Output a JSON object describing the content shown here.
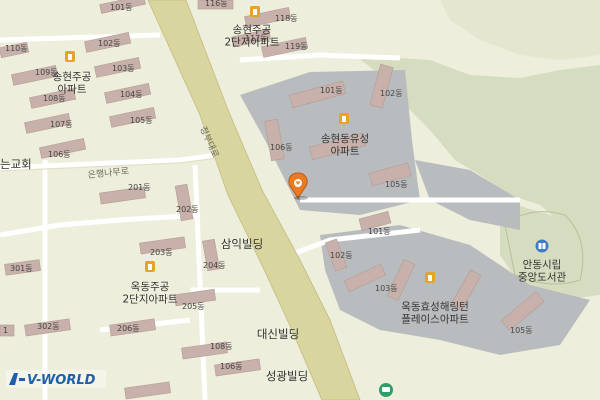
{
  "map": {
    "provider": "V-WORLD",
    "road_labels": {
      "main": "정부대로",
      "side": "은행나무로"
    },
    "places": {
      "sh2": "송현주공\n2단지아파트",
      "sh1": "송현주공\n아파트",
      "shd": "송현동유성\n아파트",
      "ok2": "옥동주공\n2단지아파트",
      "okh": "옥동효성해링턴\n플레이스아파트",
      "lib": "안동시립\n중앙도서관",
      "samik": "삼익빌딩",
      "daesin": "대신빌딩",
      "seokwang": "성광빌딩",
      "church": "는교회"
    },
    "buildings": [
      {
        "t": "101동"
      },
      {
        "t": "116동"
      },
      {
        "t": "110동"
      },
      {
        "t": "102동"
      },
      {
        "t": "118동"
      },
      {
        "t": "117동"
      },
      {
        "t": "119동"
      },
      {
        "t": "109동"
      },
      {
        "t": "103동"
      },
      {
        "t": "108동"
      },
      {
        "t": "104동"
      },
      {
        "t": "107동"
      },
      {
        "t": "105동"
      },
      {
        "t": "106동"
      },
      {
        "t": "101동"
      },
      {
        "t": "102동"
      },
      {
        "t": "106동"
      },
      {
        "t": "105동"
      },
      {
        "t": "101동"
      },
      {
        "t": "102동"
      },
      {
        "t": "103동"
      },
      {
        "t": "105동"
      },
      {
        "t": "201동"
      },
      {
        "t": "202동"
      },
      {
        "t": "203동"
      },
      {
        "t": "204동"
      },
      {
        "t": "205동"
      },
      {
        "t": "206동"
      },
      {
        "t": "301동"
      },
      {
        "t": "302동"
      },
      {
        "t": "108동"
      },
      {
        "t": "106동"
      },
      {
        "t": "1"
      }
    ]
  },
  "colors": {
    "land": "#eeeedc",
    "road": "#d9d59e",
    "park": "#d5dcbf",
    "complex": "#b9bcbf",
    "building": "#c8b1aa",
    "poi": "#e8a227",
    "marker": "#ec7a22",
    "library": "#3f7cc4"
  }
}
